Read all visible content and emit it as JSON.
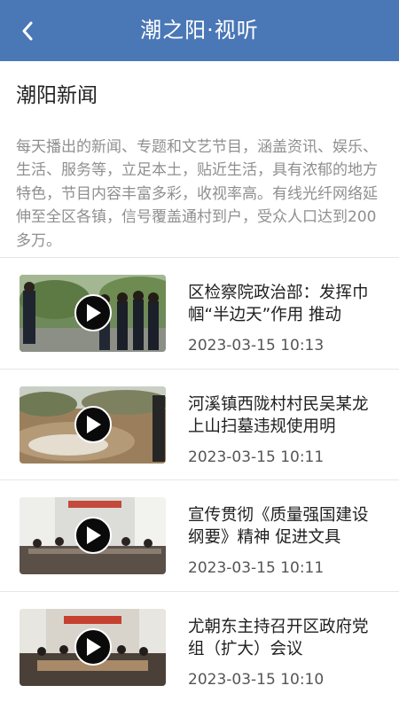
{
  "header": {
    "title": "潮之阳·视听",
    "background": "#4a77b6"
  },
  "section": {
    "title": "潮阳新闻",
    "description": "每天播出的新闻、专题和文艺节目，涵盖资讯、娱乐、生活、服务等，立足本土，贴近生活，具有浓郁的地方特色，节目内容丰富多彩，收视率高。有线光纤网络延伸至全区各镇，信号覆盖通村到户，受众人口达到200多万。"
  },
  "news_items": [
    {
      "title": "区检察院政治部：发挥巾帼“半边天”作用  推动",
      "time": "2023-03-15 10:13"
    },
    {
      "title": "河溪镇西陇村村民吴某龙上山扫墓违规使用明",
      "time": "2023-03-15 10:11"
    },
    {
      "title": "宣传贯彻《质量强国建设纲要》精神 促进文具",
      "time": "2023-03-15 10:11"
    },
    {
      "title": "尤朝东主持召开区政府党组（扩大）会议",
      "time": "2023-03-15 10:10"
    }
  ]
}
